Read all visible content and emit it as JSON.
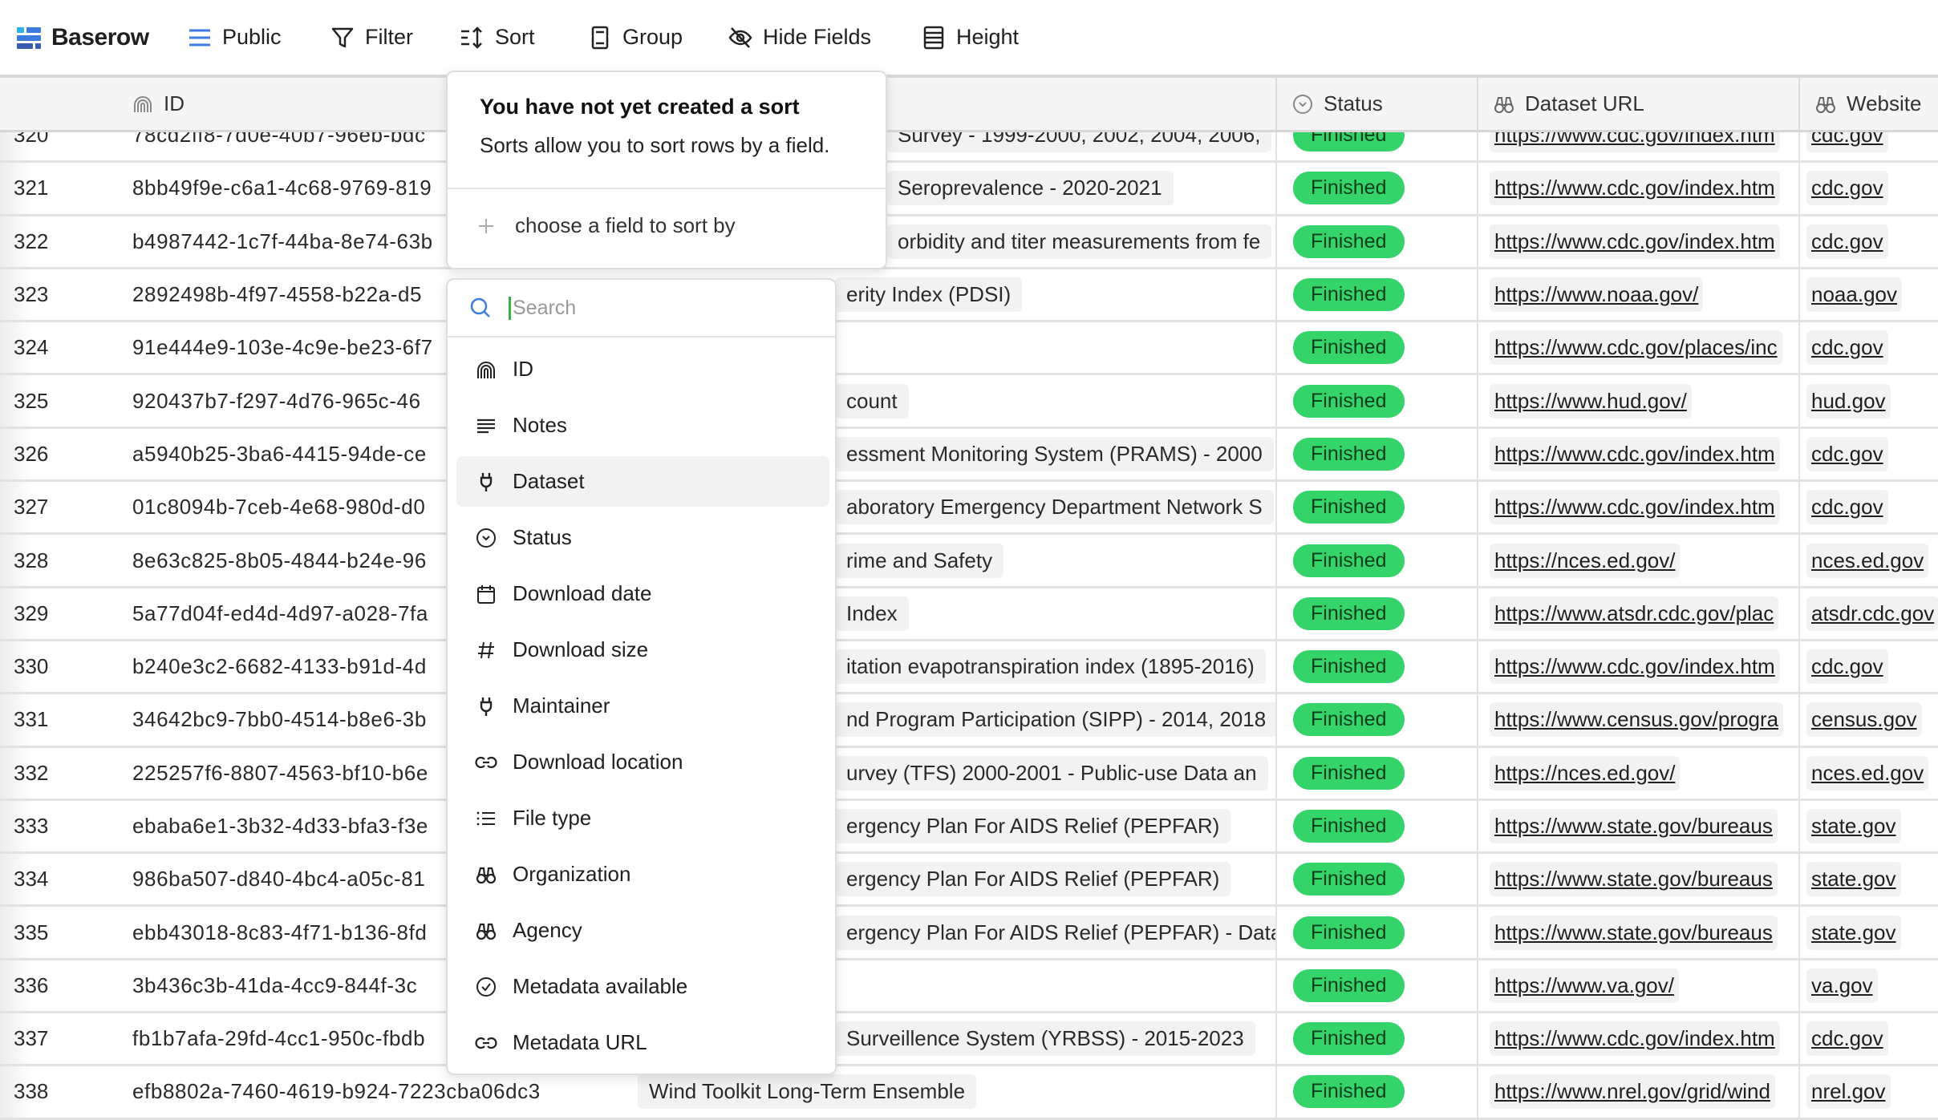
{
  "toolbar": {
    "brand": "Baserow",
    "items": [
      {
        "label": "Public",
        "icon": "list-icon"
      },
      {
        "label": "Filter",
        "icon": "filter-icon"
      },
      {
        "label": "Sort",
        "icon": "sort-icon"
      },
      {
        "label": "Group",
        "icon": "group-icon"
      },
      {
        "label": "Hide Fields",
        "icon": "eye-off-icon"
      },
      {
        "label": "Height",
        "icon": "height-icon"
      }
    ],
    "brand_colors": [
      "#2ab5e8",
      "#3d7be0",
      "#3a5bb0"
    ]
  },
  "columns": {
    "id": "ID",
    "status": "Status",
    "dataset_url": "Dataset URL",
    "website": "Website"
  },
  "rows": [
    {
      "num": "320",
      "id": "78cd2ff8-7d0e-40b7-96eb-bdc",
      "dataset": "Survey - 1999-2000, 2002, 2004, 2006,",
      "status": "Finished",
      "url": "https://www.cdc.gov/index.htm",
      "website": "cdc.gov"
    },
    {
      "num": "321",
      "id": "8bb49f9e-c6a1-4c68-9769-819",
      "dataset": "Seroprevalence - 2020-2021",
      "status": "Finished",
      "url": "https://www.cdc.gov/index.htm",
      "website": "cdc.gov"
    },
    {
      "num": "322",
      "id": "b4987442-1c7f-44ba-8e74-63b",
      "dataset": "orbidity and titer measurements from fe",
      "status": "Finished",
      "url": "https://www.cdc.gov/index.htm",
      "website": "cdc.gov"
    },
    {
      "num": "323",
      "id": "2892498b-4f97-4558-b22a-d5",
      "dataset": "erity Index (PDSI)",
      "status": "Finished",
      "url": "https://www.noaa.gov/",
      "website": "noaa.gov"
    },
    {
      "num": "324",
      "id": "91e444e9-103e-4c9e-be23-6f7",
      "dataset": "",
      "status": "Finished",
      "url": "https://www.cdc.gov/places/inc",
      "website": "cdc.gov"
    },
    {
      "num": "325",
      "id": "920437b7-f297-4d76-965c-46",
      "dataset": "count",
      "status": "Finished",
      "url": "https://www.hud.gov/",
      "website": "hud.gov"
    },
    {
      "num": "326",
      "id": "a5940b25-3ba6-4415-94de-ce",
      "dataset": "essment Monitoring System (PRAMS) - 2000",
      "status": "Finished",
      "url": "https://www.cdc.gov/index.htm",
      "website": "cdc.gov"
    },
    {
      "num": "327",
      "id": "01c8094b-7ceb-4e68-980d-d0",
      "dataset": "aboratory Emergency Department Network S",
      "status": "Finished",
      "url": "https://www.cdc.gov/index.htm",
      "website": "cdc.gov"
    },
    {
      "num": "328",
      "id": "8e63c825-8b05-4844-b24e-96",
      "dataset": "rime and Safety",
      "status": "Finished",
      "url": "https://nces.ed.gov/",
      "website": "nces.ed.gov"
    },
    {
      "num": "329",
      "id": "5a77d04f-ed4d-4d97-a028-7fa",
      "dataset": "Index",
      "status": "Finished",
      "url": "https://www.atsdr.cdc.gov/plac",
      "website": "atsdr.cdc.gov"
    },
    {
      "num": "330",
      "id": "b240e3c2-6682-4133-b91d-4d",
      "dataset": "itation evapotranspiration index (1895-2016)",
      "status": "Finished",
      "url": "https://www.cdc.gov/index.htm",
      "website": "cdc.gov"
    },
    {
      "num": "331",
      "id": "34642bc9-7bb0-4514-b8e6-3b",
      "dataset": "nd Program Participation (SIPP) - 2014, 2018",
      "status": "Finished",
      "url": "https://www.census.gov/progra",
      "website": "census.gov"
    },
    {
      "num": "332",
      "id": "225257f6-8807-4563-bf10-b6e",
      "dataset": "urvey (TFS) 2000-2001 - Public-use Data an",
      "status": "Finished",
      "url": "https://nces.ed.gov/",
      "website": "nces.ed.gov"
    },
    {
      "num": "333",
      "id": "ebaba6e1-3b32-4d33-bfa3-f3e",
      "dataset": "ergency Plan For AIDS Relief (PEPFAR)",
      "status": "Finished",
      "url": "https://www.state.gov/bureaus",
      "website": "state.gov"
    },
    {
      "num": "334",
      "id": "986ba507-d840-4bc4-a05c-81",
      "dataset": "ergency Plan For AIDS Relief (PEPFAR)",
      "status": "Finished",
      "url": "https://www.state.gov/bureaus",
      "website": "state.gov"
    },
    {
      "num": "335",
      "id": "ebb43018-8c83-4f71-b136-8fd",
      "dataset": "ergency Plan For AIDS Relief (PEPFAR) - Data",
      "status": "Finished",
      "url": "https://www.state.gov/bureaus",
      "website": "state.gov"
    },
    {
      "num": "336",
      "id": "3b436c3b-41da-4cc9-844f-3c",
      "dataset": "",
      "status": "Finished",
      "url": "https://www.va.gov/",
      "website": "va.gov"
    },
    {
      "num": "337",
      "id": "fb1b7afa-29fd-4cc1-950c-fbdb",
      "dataset": "Surveillence System (YRBSS) - 2015-2023",
      "status": "Finished",
      "url": "https://www.cdc.gov/index.htm",
      "website": "cdc.gov"
    },
    {
      "num": "338",
      "id": "efb8802a-7460-4619-b924-7223cba06dc3",
      "dataset": "Wind Toolkit Long-Term Ensemble",
      "status": "Finished",
      "url": "https://www.nrel.gov/grid/wind",
      "website": "nrel.gov"
    }
  ],
  "status_color": "#35d46a",
  "sort_popover": {
    "title": "You have not yet created a sort",
    "description": "Sorts allow you to sort rows by a field.",
    "add_label": "choose a field to sort by"
  },
  "field_dropdown": {
    "search_placeholder": "Search",
    "highlighted": "Dataset",
    "fields": [
      {
        "label": "ID",
        "icon": "fingerprint-icon"
      },
      {
        "label": "Notes",
        "icon": "text-lines-icon"
      },
      {
        "label": "Dataset",
        "icon": "plug-icon"
      },
      {
        "label": "Status",
        "icon": "circle-chevron-icon"
      },
      {
        "label": "Download date",
        "icon": "calendar-icon"
      },
      {
        "label": "Download size",
        "icon": "hash-icon"
      },
      {
        "label": "Maintainer",
        "icon": "plug-icon"
      },
      {
        "label": "Download location",
        "icon": "link-icon"
      },
      {
        "label": "File type",
        "icon": "list-icon"
      },
      {
        "label": "Organization",
        "icon": "binoculars-icon"
      },
      {
        "label": "Agency",
        "icon": "binoculars-icon"
      },
      {
        "label": "Metadata available",
        "icon": "circle-check-icon"
      },
      {
        "label": "Metadata URL",
        "icon": "link-icon"
      }
    ]
  }
}
